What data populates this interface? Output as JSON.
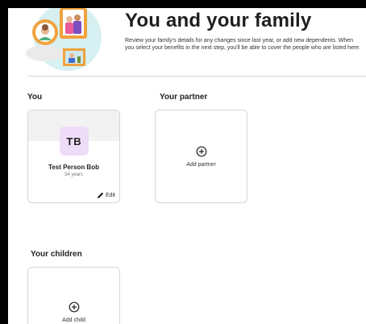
{
  "header": {
    "title": "You and your family",
    "description": "Review your family's details for any changes since last year, or add new dependents. When you select your benefits in the next step, you'll be able to cover the people who are listed here."
  },
  "sections": {
    "you": {
      "label": "You",
      "initials": "TB",
      "name": "Test Person Bob",
      "age": "34 years",
      "edit_label": "Edit",
      "edit_icon": "pencil-icon"
    },
    "partner": {
      "label": "Your partner",
      "add_label": "Add partner",
      "add_icon": "plus-circle-icon"
    },
    "children": {
      "label": "Your children",
      "add_label": "Add child",
      "add_icon": "plus-circle-icon"
    }
  },
  "colors": {
    "avatar_bg": "#eedcf8",
    "hero_circle": "#d7f0f2",
    "hero_orange": "#f0a23c"
  }
}
